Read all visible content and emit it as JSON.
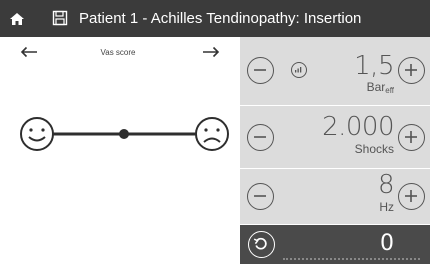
{
  "header": {
    "title": "Patient 1 - Achilles Tendinopathy: Insertion",
    "icons": [
      "home-icon",
      "save-icon"
    ]
  },
  "vas": {
    "label": "Vas score",
    "left_icon": "smiley-happy-icon",
    "right_icon": "smiley-sad-icon",
    "prev_icon": "arrow-left-icon",
    "next_icon": "arrow-right-icon"
  },
  "pressure": {
    "value": "1,5",
    "unit_main": "Bar",
    "unit_sub": "eff"
  },
  "shocks": {
    "value": "2.000",
    "unit": "Shocks"
  },
  "frequency": {
    "value": "8",
    "unit": "Hz"
  },
  "counter": {
    "value": "0"
  },
  "colors": {
    "header_bg": "#3b3b3b",
    "row_bg": "#dcdcdc",
    "counter_bg": "#4a4a4a"
  }
}
